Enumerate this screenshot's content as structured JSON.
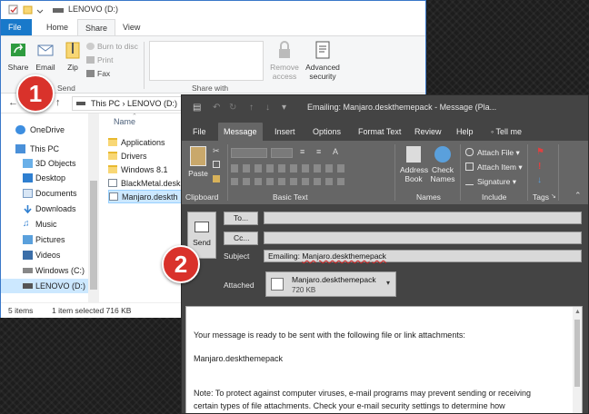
{
  "explorer": {
    "title": "LENOVO (D:)",
    "tabs": [
      "File",
      "Home",
      "Share",
      "View"
    ],
    "ribbon": {
      "share": "Share",
      "email": "Email",
      "zip": "Zip",
      "burn": "Burn to disc",
      "print": "Print",
      "fax": "Fax",
      "send_group": "Send",
      "share_with_group": "Share with",
      "remove_access": "Remove access",
      "advanced_security": "Advanced security"
    },
    "address": {
      "this_pc": "This PC",
      "drive": "LENOVO (D:)"
    },
    "nav": [
      "OneDrive",
      "This PC",
      "3D Objects",
      "Desktop",
      "Documents",
      "Downloads",
      "Music",
      "Pictures",
      "Videos",
      "Windows (C:)",
      "LENOVO (D:)"
    ],
    "column_name": "Name",
    "files": [
      "Applications",
      "Drivers",
      "Windows 8.1",
      "BlackMetal.desk",
      "Manjaro.deskth"
    ],
    "status_items": "5 items",
    "status_selected": "1 item selected  716 KB"
  },
  "outlook": {
    "title": "Emailing: Manjaro.deskthemepack - Message (Pla...",
    "tabs": [
      "File",
      "Message",
      "Insert",
      "Options",
      "Format Text",
      "Review",
      "Help",
      "Tell me"
    ],
    "ribbon": {
      "paste": "Paste",
      "clipboard": "Clipboard",
      "basic_text": "Basic Text",
      "address_book": "Address Book",
      "check_names": "Check Names",
      "names": "Names",
      "attach_file": "Attach File",
      "attach_item": "Attach Item",
      "signature": "Signature",
      "include": "Include",
      "tags": "Tags"
    },
    "send": "Send",
    "to": "To...",
    "cc": "Cc...",
    "subject_label": "Subject",
    "subject_prefix": "Emailing: ",
    "subject_file": "Manjaro.deskthemepack",
    "attached_label": "Attached",
    "attachment_name": "Manjaro.deskthemepack",
    "attachment_size": "720 KB",
    "body_line1": "Your message is ready to be sent with the following file or link attachments:",
    "body_line2": "Manjaro.deskthemepack",
    "body_line3": "Note: To protect against computer viruses, e-mail programs may prevent sending or receiving",
    "body_line4": "certain types of file attachments.  Check your e-mail security settings to determine how"
  },
  "markers": [
    "1",
    "2"
  ],
  "colors": {
    "explorer_file_tab": "#1979ca",
    "outlook_ribbon": "#666666",
    "outlook_chrome": "#444444",
    "marker": "#d9322b"
  }
}
